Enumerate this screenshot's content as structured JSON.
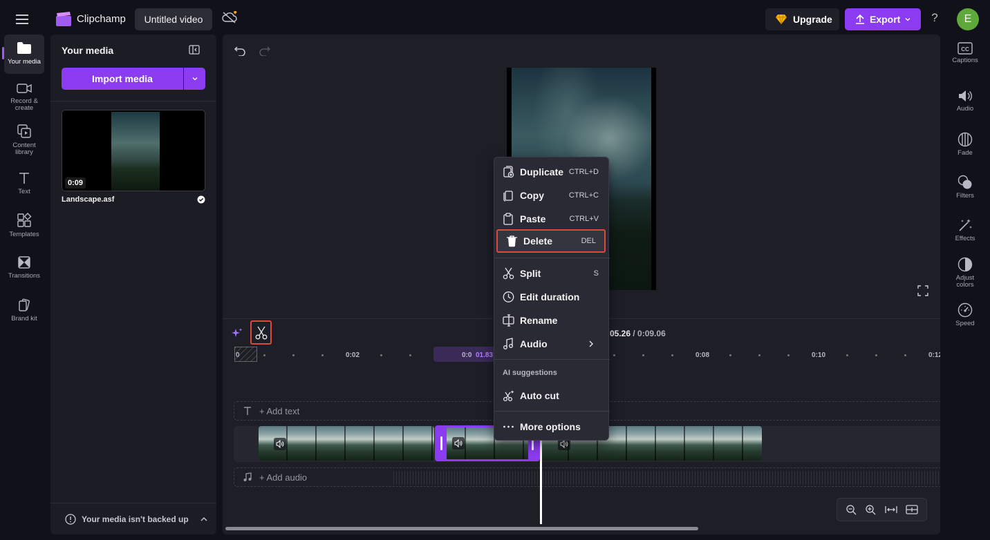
{
  "header": {
    "app_name": "Clipchamp",
    "project_title": "Untitled video",
    "upgrade_label": "Upgrade",
    "export_label": "Export",
    "help_label": "?",
    "avatar_initial": "E"
  },
  "left_rail": {
    "items": [
      {
        "label": "Your media",
        "icon": "folder-icon",
        "active": true
      },
      {
        "label": "Record & create",
        "icon": "camera-icon"
      },
      {
        "label": "Content library",
        "icon": "library-icon"
      },
      {
        "label": "Text",
        "icon": "text-icon"
      },
      {
        "label": "Templates",
        "icon": "templates-icon"
      },
      {
        "label": "Transitions",
        "icon": "transitions-icon"
      },
      {
        "label": "Brand kit",
        "icon": "brand-kit-icon"
      }
    ]
  },
  "media_panel": {
    "title": "Your media",
    "import_label": "Import media",
    "file": {
      "name": "Landscape.asf",
      "duration": "0:09"
    },
    "backup_notice": "Your media isn't backed up"
  },
  "timeline": {
    "current_time": "05.26",
    "total_time": "/ 0:09.06",
    "ruler_start": "0",
    "ruler_labels": [
      "0:02",
      "0:0",
      "0:08",
      "0:10",
      "0:12"
    ],
    "ruler_current": "01.83",
    "add_text_label": "+ Add text",
    "add_audio_label": "+ Add audio"
  },
  "context_menu": {
    "items": [
      {
        "label": "Duplicate",
        "shortcut": "CTRL+D",
        "icon": "duplicate-icon"
      },
      {
        "label": "Copy",
        "shortcut": "CTRL+C",
        "icon": "copy-icon"
      },
      {
        "label": "Paste",
        "shortcut": "CTRL+V",
        "icon": "paste-icon"
      },
      {
        "label": "Delete",
        "shortcut": "DEL",
        "icon": "trash-icon"
      },
      {
        "label": "Split",
        "shortcut": "S",
        "icon": "scissors-icon"
      },
      {
        "label": "Edit duration",
        "shortcut": "",
        "icon": "clock-icon"
      },
      {
        "label": "Rename",
        "shortcut": "",
        "icon": "rename-icon"
      },
      {
        "label": "Audio",
        "shortcut": "",
        "icon": "music-note-icon"
      }
    ],
    "ai_section_label": "AI suggestions",
    "ai_items": [
      {
        "label": "Auto cut",
        "icon": "auto-cut-icon"
      }
    ],
    "more_label": "More options"
  },
  "right_rail": {
    "items": [
      {
        "label": "Captions",
        "icon": "captions-icon"
      },
      {
        "label": "Audio",
        "icon": "speaker-icon"
      },
      {
        "label": "Fade",
        "icon": "fade-icon"
      },
      {
        "label": "Filters",
        "icon": "filters-icon"
      },
      {
        "label": "Effects",
        "icon": "effects-icon"
      },
      {
        "label": "Adjust colors",
        "icon": "adjust-colors-icon"
      },
      {
        "label": "Speed",
        "icon": "speed-icon"
      }
    ]
  },
  "colors": {
    "accent": "#8c3cf0",
    "highlight": "#e0483e",
    "background": "#111119",
    "panel": "#1c1c25"
  }
}
